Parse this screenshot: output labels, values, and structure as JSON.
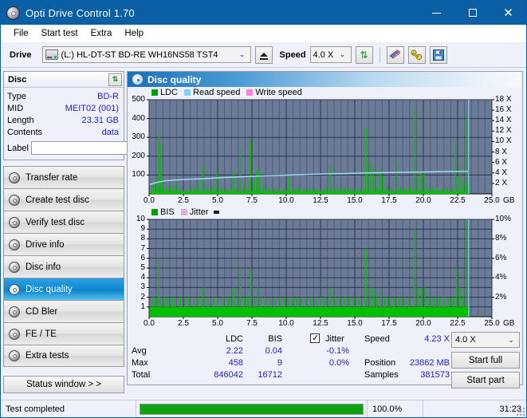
{
  "window": {
    "title": "Opti Drive Control 1.70",
    "icon": "disc-icon",
    "minimize": "minimize-icon",
    "maximize": "maximize-icon",
    "close": "close-icon"
  },
  "menubar": {
    "items": [
      "File",
      "Start test",
      "Extra",
      "Help"
    ]
  },
  "toolbar": {
    "drive_label": "Drive",
    "drive_value": "(L:)  HL-DT-ST BD-RE  WH16NS58 TST4",
    "eject_icon": "eject-icon",
    "speed_label": "Speed",
    "speed_value": "4.0 X",
    "refresh_icon": "refresh-icon",
    "erase_icon": "eraser-icon",
    "tools_icon": "tools-icon",
    "save_icon": "save-icon"
  },
  "disc_panel": {
    "title": "Disc",
    "refresh_icon": "refresh-icon",
    "rows": [
      {
        "key": "Type",
        "value": "BD-R"
      },
      {
        "key": "MID",
        "value": "MEIT02 (001)"
      },
      {
        "key": "Length",
        "value": "23.31 GB"
      },
      {
        "key": "Contents",
        "value": "data"
      }
    ],
    "label_key": "Label",
    "label_value": "",
    "label_placeholder": "",
    "disc_button_icon": "disc-icon"
  },
  "nav": {
    "items": [
      {
        "label": "Transfer rate",
        "icon": "disc-icon",
        "active": false
      },
      {
        "label": "Create test disc",
        "icon": "disc-icon",
        "active": false
      },
      {
        "label": "Verify test disc",
        "icon": "disc-icon",
        "active": false
      },
      {
        "label": "Drive info",
        "icon": "disc-icon",
        "active": false
      },
      {
        "label": "Disc info",
        "icon": "disc-icon",
        "active": false
      },
      {
        "label": "Disc quality",
        "icon": "disc-icon",
        "active": true
      },
      {
        "label": "CD Bler",
        "icon": "disc-icon",
        "active": false
      },
      {
        "label": "FE / TE",
        "icon": "disc-icon",
        "active": false
      },
      {
        "label": "Extra tests",
        "icon": "disc-icon",
        "active": false
      }
    ],
    "status_window": "Status window > >"
  },
  "content": {
    "title": "Disc quality",
    "icon": "disc-icon"
  },
  "stats": {
    "col_ldc": "LDC",
    "col_bis": "BIS",
    "row_avg": "Avg",
    "row_max": "Max",
    "row_total": "Total",
    "avg_ldc": "2.22",
    "avg_bis": "0.04",
    "max_ldc": "458",
    "max_bis": "9",
    "total_ldc": "846042",
    "total_bis": "16712",
    "jitter_label": "Jitter",
    "jitter_checked": true,
    "jitter_avg": "-0.1%",
    "jitter_max": "0.0%",
    "speed_label": "Speed",
    "speed_value": "4.23 X",
    "position_label": "Position",
    "position_value": "23862 MB",
    "samples_label": "Samples",
    "samples_value": "381573",
    "speed_select": "4.0 X",
    "start_full": "Start full",
    "start_part": "Start part"
  },
  "statusbar": {
    "status": "Test completed",
    "progress_pct": "100.0%",
    "progress_value": 100,
    "elapsed": "31:23"
  },
  "colors": {
    "ldc_green": "#00c000",
    "read_speed_blue": "#7fd4f5",
    "write_speed_pink": "#ff7fe0",
    "bis_green": "#00c000",
    "jitter_pink": "#d8b0d8",
    "plot_bg": "#6b7a96",
    "title_blue": "#0b5fa5",
    "value_blue": "#2222cc",
    "progress_green": "#10a010"
  },
  "chart_data": [
    {
      "type": "line",
      "name": "disc-quality-ldc-chart",
      "title": "",
      "xlabel": "GB",
      "ylabel": "LDC",
      "legend": [
        {
          "label": "LDC",
          "color": "#00a000"
        },
        {
          "label": "Read speed",
          "color": "#7fd4f5"
        },
        {
          "label": "Write speed",
          "color": "#ff7fe0"
        }
      ],
      "legend_position": "top-left",
      "grid": true,
      "xlim": [
        0,
        25.0
      ],
      "xticks": [
        0.0,
        2.5,
        5.0,
        7.5,
        10.0,
        12.5,
        15.0,
        17.5,
        20.0,
        22.5,
        25.0
      ],
      "xtick_labels": [
        "0.0",
        "2.5",
        "5.0",
        "7.5",
        "10.0",
        "12.5",
        "15.0",
        "17.5",
        "20.0",
        "22.5",
        "25.0"
      ],
      "x_unit": "GB",
      "ylim": [
        0,
        500
      ],
      "yticks": [
        100,
        200,
        300,
        400,
        500
      ],
      "ytick_labels": [
        "100",
        "200",
        "300",
        "400",
        "500"
      ],
      "y2lim": [
        0,
        18
      ],
      "y2ticks": [
        2,
        4,
        6,
        8,
        10,
        12,
        14,
        16,
        18
      ],
      "y2tick_labels": [
        "2 X",
        "4 X",
        "6 X",
        "8 X",
        "10 X",
        "12 X",
        "14 X",
        "16 X",
        "18 X"
      ],
      "data_end_x": 23.31,
      "series": [
        {
          "name": "LDC",
          "type": "spikes",
          "color": "#00c000",
          "baseline": 14,
          "spikes": [
            [
              0.3,
              60
            ],
            [
              0.45,
              40
            ],
            [
              0.62,
              95
            ],
            [
              0.72,
              325
            ],
            [
              0.78,
              275
            ],
            [
              0.85,
              110
            ],
            [
              0.95,
              70
            ],
            [
              1.25,
              35
            ],
            [
              1.6,
              45
            ],
            [
              1.95,
              55
            ],
            [
              2.35,
              40
            ],
            [
              2.7,
              30
            ],
            [
              3.05,
              45
            ],
            [
              3.35,
              30
            ],
            [
              3.55,
              55
            ],
            [
              3.95,
              150
            ],
            [
              4.25,
              35
            ],
            [
              4.6,
              40
            ],
            [
              4.95,
              120
            ],
            [
              5.3,
              35
            ],
            [
              5.6,
              30
            ],
            [
              5.95,
              30
            ],
            [
              6.15,
              115
            ],
            [
              6.4,
              35
            ],
            [
              6.65,
              245
            ],
            [
              6.95,
              60
            ],
            [
              7.25,
              30
            ],
            [
              7.42,
              280
            ],
            [
              7.65,
              65
            ],
            [
              7.85,
              125
            ],
            [
              8.0,
              130
            ],
            [
              8.35,
              45
            ],
            [
              8.7,
              30
            ],
            [
              9.1,
              35
            ],
            [
              9.45,
              40
            ],
            [
              9.8,
              35
            ],
            [
              10.2,
              90
            ],
            [
              10.55,
              35
            ],
            [
              10.9,
              30
            ],
            [
              11.3,
              35
            ],
            [
              11.7,
              30
            ],
            [
              12.1,
              35
            ],
            [
              12.45,
              30
            ],
            [
              12.85,
              40
            ],
            [
              13.2,
              150
            ],
            [
              13.55,
              35
            ],
            [
              13.95,
              30
            ],
            [
              14.3,
              40
            ],
            [
              14.65,
              35
            ],
            [
              15.05,
              35
            ],
            [
              15.4,
              30
            ],
            [
              15.8,
              350
            ],
            [
              15.95,
              120
            ],
            [
              16.15,
              165
            ],
            [
              16.35,
              125
            ],
            [
              16.6,
              35
            ],
            [
              16.85,
              130
            ],
            [
              17.05,
              95
            ],
            [
              17.35,
              40
            ],
            [
              17.7,
              35
            ],
            [
              18.05,
              180
            ],
            [
              18.35,
              35
            ],
            [
              18.7,
              30
            ],
            [
              19.05,
              45
            ],
            [
              19.35,
              455
            ],
            [
              19.55,
              90
            ],
            [
              19.85,
              110
            ],
            [
              20.05,
              115
            ],
            [
              20.35,
              40
            ],
            [
              20.65,
              35
            ],
            [
              21.0,
              35
            ],
            [
              21.4,
              30
            ],
            [
              21.75,
              35
            ],
            [
              22.1,
              35
            ],
            [
              22.35,
              285
            ],
            [
              22.5,
              95
            ],
            [
              22.7,
              150
            ],
            [
              22.9,
              60
            ],
            [
              23.15,
              420
            ],
            [
              23.25,
              60
            ]
          ]
        },
        {
          "name": "Read speed",
          "type": "line",
          "color": "#9fe0ff",
          "axis": "right",
          "points": [
            [
              0.05,
              1.8
            ],
            [
              0.6,
              2.2
            ],
            [
              1.2,
              2.5
            ],
            [
              2.2,
              2.7
            ],
            [
              3.0,
              2.8
            ],
            [
              4.0,
              2.9
            ],
            [
              5.2,
              3.1
            ],
            [
              6.2,
              3.2
            ],
            [
              7.0,
              3.3
            ],
            [
              8.0,
              3.4
            ],
            [
              9.0,
              3.5
            ],
            [
              10.2,
              3.6
            ],
            [
              11.4,
              3.7
            ],
            [
              12.6,
              3.8
            ],
            [
              13.5,
              3.85
            ],
            [
              14.6,
              3.9
            ],
            [
              15.6,
              4.0
            ],
            [
              16.8,
              4.05
            ],
            [
              18.0,
              4.1
            ],
            [
              19.2,
              4.15
            ],
            [
              20.4,
              4.2
            ],
            [
              21.6,
              4.25
            ],
            [
              22.8,
              4.3
            ],
            [
              23.25,
              4.3
            ]
          ]
        },
        {
          "name": "end-marker",
          "type": "vline",
          "color": "#5ec8f0",
          "x": 23.3
        }
      ]
    },
    {
      "type": "line",
      "name": "disc-quality-bis-chart",
      "title": "",
      "xlabel": "GB",
      "ylabel": "BIS",
      "legend": [
        {
          "label": "BIS",
          "color": "#00a000"
        },
        {
          "label": "Jitter",
          "color": "#d8b0d8"
        }
      ],
      "legend_position": "top-left",
      "grid": true,
      "xlim": [
        0,
        25.0
      ],
      "xticks": [
        0.0,
        2.5,
        5.0,
        7.5,
        10.0,
        12.5,
        15.0,
        17.5,
        20.0,
        22.5,
        25.0
      ],
      "xtick_labels": [
        "0.0",
        "2.5",
        "5.0",
        "7.5",
        "10.0",
        "12.5",
        "15.0",
        "17.5",
        "20.0",
        "22.5",
        "25.0"
      ],
      "x_unit": "GB",
      "ylim": [
        0,
        10
      ],
      "yticks": [
        1,
        2,
        3,
        4,
        5,
        6,
        7,
        8,
        9,
        10
      ],
      "ytick_labels": [
        "1",
        "2",
        "3",
        "4",
        "5",
        "6",
        "7",
        "8",
        "9",
        "10"
      ],
      "y2lim": [
        0,
        10
      ],
      "y2ticks": [
        2,
        4,
        6,
        8,
        10
      ],
      "y2tick_labels": [
        "2%",
        "4%",
        "6%",
        "8%",
        "10%"
      ],
      "data_end_x": 23.31,
      "series": [
        {
          "name": "BIS",
          "type": "spikes",
          "color": "#00c000",
          "baseline": 1.0,
          "spikes": [
            [
              0.25,
              2
            ],
            [
              0.45,
              2
            ],
            [
              0.62,
              2
            ],
            [
              0.72,
              6
            ],
            [
              0.85,
              2
            ],
            [
              1.1,
              2
            ],
            [
              1.35,
              2
            ],
            [
              1.65,
              2
            ],
            [
              1.85,
              2
            ],
            [
              2.3,
              2
            ],
            [
              2.6,
              2
            ],
            [
              2.9,
              2
            ],
            [
              3.3,
              2
            ],
            [
              3.55,
              2
            ],
            [
              3.95,
              3
            ],
            [
              4.3,
              2
            ],
            [
              4.7,
              2
            ],
            [
              5.0,
              2
            ],
            [
              5.4,
              2
            ],
            [
              5.8,
              2
            ],
            [
              6.15,
              3
            ],
            [
              6.45,
              2
            ],
            [
              6.65,
              5
            ],
            [
              6.95,
              2
            ],
            [
              7.2,
              2
            ],
            [
              7.45,
              5
            ],
            [
              7.7,
              2
            ],
            [
              7.95,
              3
            ],
            [
              8.15,
              2
            ],
            [
              8.5,
              2
            ],
            [
              8.85,
              2
            ],
            [
              9.2,
              2
            ],
            [
              9.55,
              2
            ],
            [
              9.85,
              2
            ],
            [
              10.15,
              2
            ],
            [
              10.45,
              2
            ],
            [
              10.8,
              2
            ],
            [
              11.1,
              2
            ],
            [
              11.45,
              2
            ],
            [
              11.8,
              2
            ],
            [
              12.15,
              2
            ],
            [
              12.5,
              2
            ],
            [
              12.85,
              2
            ],
            [
              13.2,
              3
            ],
            [
              13.55,
              2
            ],
            [
              13.9,
              2
            ],
            [
              14.25,
              2
            ],
            [
              14.6,
              2
            ],
            [
              14.95,
              2
            ],
            [
              15.3,
              2
            ],
            [
              15.8,
              7
            ],
            [
              16.1,
              3
            ],
            [
              16.35,
              3
            ],
            [
              16.6,
              2
            ],
            [
              16.9,
              3
            ],
            [
              17.2,
              2
            ],
            [
              17.55,
              2
            ],
            [
              17.9,
              2
            ],
            [
              18.25,
              2
            ],
            [
              18.6,
              2
            ],
            [
              18.95,
              2
            ],
            [
              19.35,
              9
            ],
            [
              19.6,
              3
            ],
            [
              19.9,
              3
            ],
            [
              20.1,
              3
            ],
            [
              20.45,
              2
            ],
            [
              20.8,
              2
            ],
            [
              21.15,
              2
            ],
            [
              21.5,
              2
            ],
            [
              21.85,
              2
            ],
            [
              22.2,
              2
            ],
            [
              22.45,
              5
            ],
            [
              22.65,
              3
            ],
            [
              22.9,
              2
            ],
            [
              23.15,
              10
            ]
          ]
        },
        {
          "name": "end-marker",
          "type": "vline",
          "color": "#5ec8f0",
          "x": 23.3
        }
      ]
    }
  ]
}
